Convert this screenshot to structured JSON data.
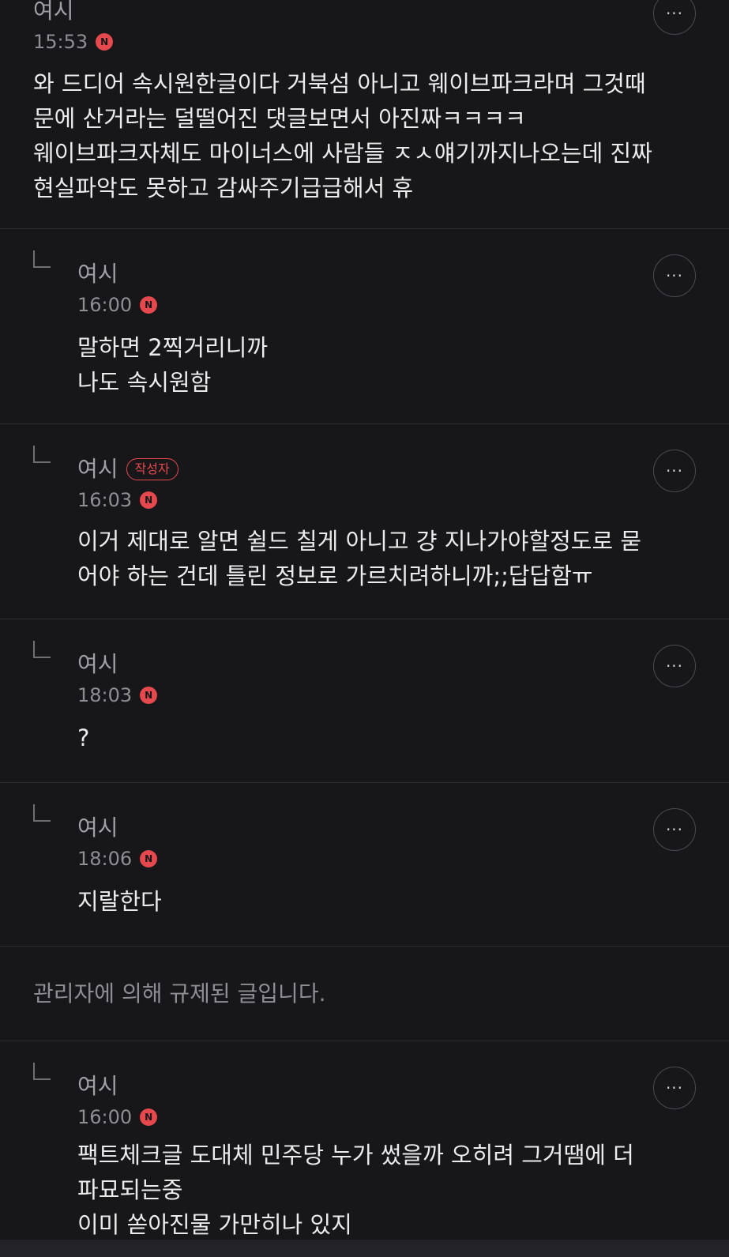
{
  "icons": {
    "more": "more-horizontal-icon",
    "new": "new-badge-icon",
    "reply": "reply-arrow-icon"
  },
  "colors": {
    "background": "#17171a",
    "accent": "#e5484d",
    "divider": "#2e2e33"
  },
  "comments": [
    {
      "author": "여시",
      "time": "15:53",
      "new_label": "N",
      "more_label": "···",
      "text": "와 드디어 속시원한글이다 거북섬 아니고 웨이브파크라며 그것때\n문에 산거라는 덜떨어진 댓글보면서 아진짜ㅋㅋㅋㅋ\n웨이브파크자체도 마이너스에 사람들 ㅈㅅ얘기까지나오는데 진짜\n현실파악도 못하고 감싸주기급급해서 휴"
    },
    {
      "author": "여시",
      "time": "16:00",
      "new_label": "N",
      "more_label": "···",
      "text": "말하면 2찍거리니까\n나도 속시원함"
    },
    {
      "author": "여시",
      "op_badge": "작성자",
      "time": "16:03",
      "new_label": "N",
      "more_label": "···",
      "text": "이거 제대로 알면 쉴드 칠게 아니고 걍 지나가야할정도로 묻\n어야 하는 건데 틀린 정보로 가르치려하니까;;답답함ㅠ"
    },
    {
      "author": "여시",
      "time": "18:03",
      "new_label": "N",
      "more_label": "···",
      "text": "?"
    },
    {
      "author": "여시",
      "time": "18:06",
      "new_label": "N",
      "more_label": "···",
      "text": "지랄한다"
    },
    {
      "notice": "관리자에 의해 규제된 글입니다."
    },
    {
      "author": "여시",
      "time": "16:00",
      "new_label": "N",
      "more_label": "···",
      "text": "팩트체크글 도대체 민주당 누가 썼을까 오히려 그거땜에 더\n파묘되는중\n이미 쏟아진물 가만히나 있지"
    }
  ]
}
